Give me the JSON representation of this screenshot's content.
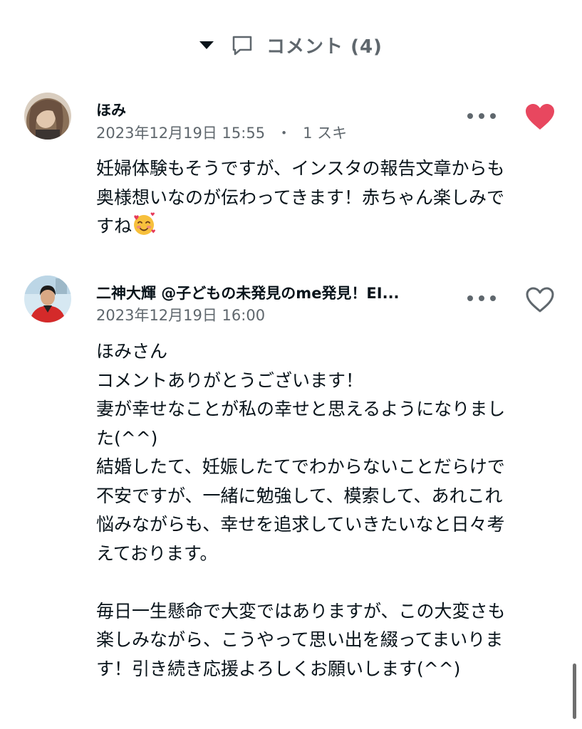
{
  "header": {
    "title": "コメント (4)"
  },
  "comments": [
    {
      "username": "ほみ",
      "timestamp": "2023年12月19日 15:55",
      "separator": "・",
      "likes": "1 スキ",
      "liked": true,
      "lines": [
        "妊婦体験もそうですが、インスタの報告文章からも",
        "奥様想いなのが伝わってきます！赤ちゃん楽しみで",
        "すね"
      ],
      "emoji": "smiling-face-with-hearts"
    },
    {
      "username": "二神大輝 @子どもの未発見のme発見！EI...",
      "timestamp": "2023年12月19日 16:00",
      "liked": false,
      "lines": [
        "ほみさん",
        "コメントありがとうございます！",
        "妻が幸せなことが私の幸せと思えるようになりまし",
        "た(^^)",
        "結婚したて、妊娠したてでわからないことだらけで",
        "不安ですが、一緒に勉強して、模索して、あれこれ",
        "悩みながらも、幸せを追求していきたいなと日々考",
        "えております。",
        "",
        "毎日一生懸命で大変ではありますが、この大変さも",
        "楽しみながら、こうやって思い出を綴ってまいりま",
        "す！引き続き応援よろしくお願いします(^^)"
      ]
    }
  ],
  "colors": {
    "heart_liked": "#e8475f",
    "heart_unliked": "#5f676d",
    "text": "#08131a",
    "muted": "#5f676d"
  },
  "icons": [
    "caret-down-icon",
    "comment-bubble-icon",
    "more-dots-icon",
    "heart-filled-icon",
    "heart-outline-icon",
    "emoji-smiling-hearts-icon"
  ]
}
